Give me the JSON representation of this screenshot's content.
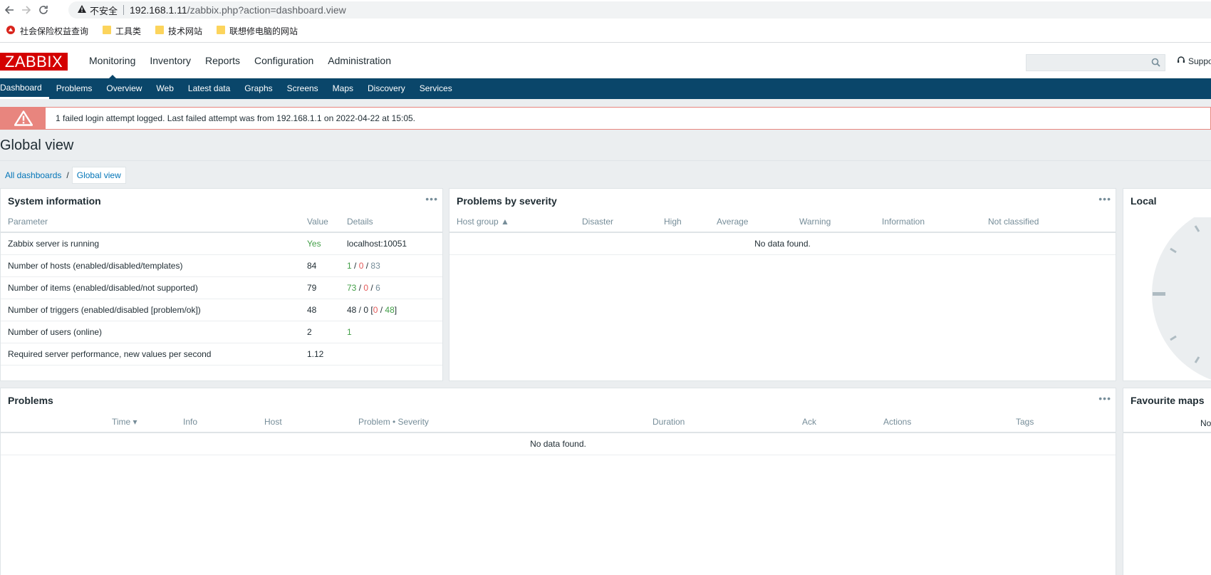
{
  "browser": {
    "security_label": "不安全",
    "url_host": "192.168.1.11",
    "url_path": "/zabbix.php?action=dashboard.view",
    "bookmarks": [
      "社会保险权益查询",
      "工具类",
      "技术网站",
      "联想修电脑的网站"
    ]
  },
  "header": {
    "logo": "ZABBIX",
    "menu": [
      "Monitoring",
      "Inventory",
      "Reports",
      "Configuration",
      "Administration"
    ],
    "support": "Suppo"
  },
  "submenu": [
    "Dashboard",
    "Problems",
    "Overview",
    "Web",
    "Latest data",
    "Graphs",
    "Screens",
    "Maps",
    "Discovery",
    "Services"
  ],
  "warning": "1 failed login attempt logged. Last failed attempt was from 192.168.1.1 on 2022-04-22 at 15:05.",
  "page_title": "Global view",
  "breadcrumb": {
    "all": "All dashboards",
    "sep": "/",
    "current": "Global view"
  },
  "system_info": {
    "title": "System information",
    "headers": [
      "Parameter",
      "Value",
      "Details"
    ],
    "rows": [
      {
        "param": "Zabbix server is running",
        "value": "Yes",
        "details": "localhost:10051"
      },
      {
        "param": "Number of hosts (enabled/disabled/templates)",
        "value": "84",
        "d1": "1",
        "d2": "0",
        "d3": "83"
      },
      {
        "param": "Number of items (enabled/disabled/not supported)",
        "value": "79",
        "d1": "73",
        "d2": "0",
        "d3": "6"
      },
      {
        "param": "Number of triggers (enabled/disabled [problem/ok])",
        "value": "48",
        "d0": "48 / 0 [",
        "d1": "0",
        "d2": "48",
        "d3": "]"
      },
      {
        "param": "Number of users (online)",
        "value": "2",
        "details": "1"
      },
      {
        "param": "Required server performance, new values per second",
        "value": "1.12",
        "details": ""
      }
    ]
  },
  "severity": {
    "title": "Problems by severity",
    "headers": [
      "Host group ▲",
      "Disaster",
      "High",
      "Average",
      "Warning",
      "Information",
      "Not classified"
    ],
    "empty": "No data found."
  },
  "local": {
    "title": "Local"
  },
  "problems": {
    "title": "Problems",
    "headers": [
      "Time ▾",
      "Info",
      "Host",
      "Problem • Severity",
      "Duration",
      "Ack",
      "Actions",
      "Tags"
    ],
    "empty": "No data found."
  },
  "fav_maps": {
    "title": "Favourite maps",
    "empty": "No"
  },
  "dots": "•••"
}
